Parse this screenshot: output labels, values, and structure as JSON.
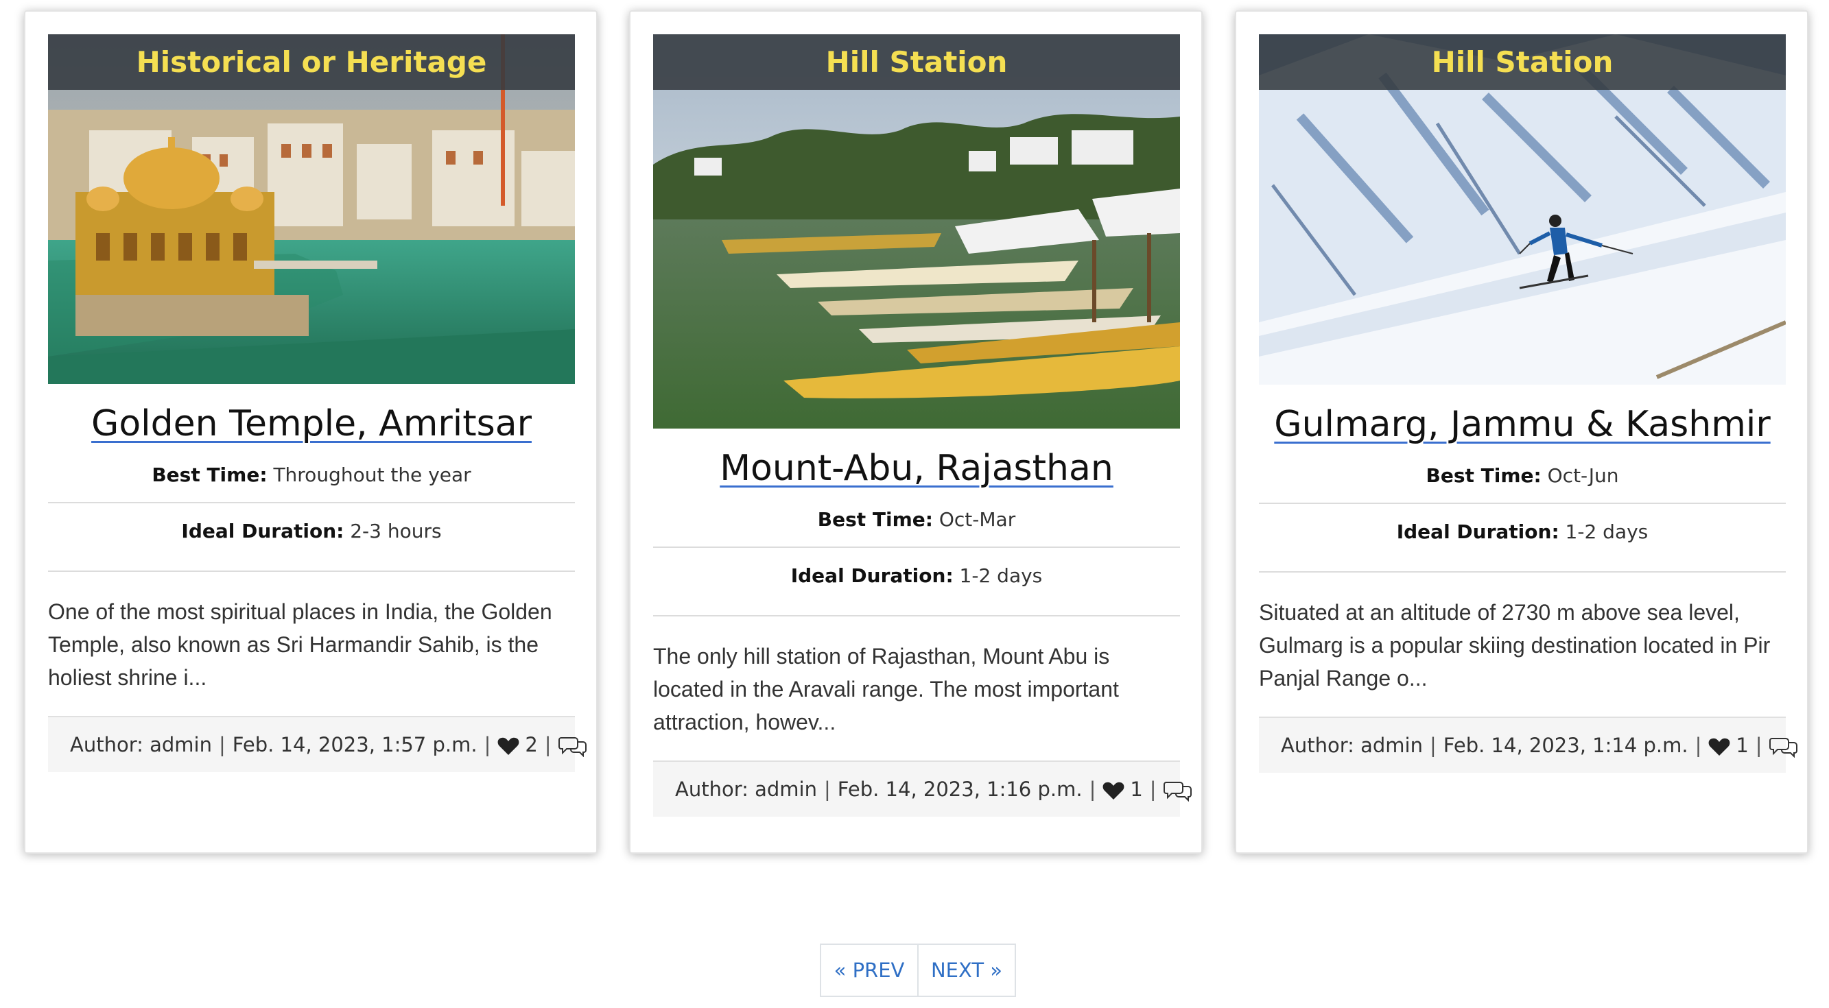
{
  "cards": [
    {
      "category": "Historical or Heritage",
      "title": "Golden Temple, Amritsar",
      "best_time_label": "Best Time:",
      "best_time": "Throughout the year",
      "duration_label": "Ideal Duration:",
      "duration": "2-3 hours",
      "description": "One of the most spiritual places in India, the Golden Temple, also known as Sri Harmandir Sahib, is the holiest shrine i...",
      "author": "Author: admin",
      "date": "Feb. 14, 2023, 1:57 p.m.",
      "likes": "2"
    },
    {
      "category": "Hill Station",
      "title": "Mount-Abu, Rajasthan",
      "best_time_label": "Best Time:",
      "best_time": "Oct-Mar",
      "duration_label": "Ideal Duration:",
      "duration": "1-2 days",
      "description": "The only hill station of Rajasthan, Mount Abu is located in the Aravali range. The most important attraction, howev...",
      "author": "Author: admin",
      "date": "Feb. 14, 2023, 1:16 p.m.",
      "likes": "1"
    },
    {
      "category": "Hill Station",
      "title": "Gulmarg, Jammu & Kashmir",
      "best_time_label": "Best Time:",
      "best_time": "Oct-Jun",
      "duration_label": "Ideal Duration:",
      "duration": "1-2 days",
      "description": "Situated at an altitude of 2730 m above sea level, Gulmarg is a popular skiing destination located in Pir Panjal Range o...",
      "author": "Author: admin",
      "date": "Feb. 14, 2023, 1:14 p.m.",
      "likes": "1"
    }
  ],
  "pagination": {
    "prev_label": "« PREV",
    "next_label": "NEXT »"
  },
  "colors": {
    "category_text": "#f5df52",
    "link": "#2f6fc5",
    "title_underline": "#3a6fcf"
  },
  "icons": {
    "like": "heart-icon",
    "comment": "comment-icon"
  }
}
